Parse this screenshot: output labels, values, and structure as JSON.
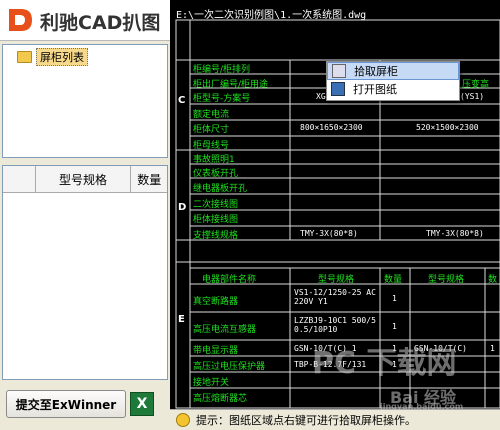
{
  "app": {
    "title": "利驰CAD扒图"
  },
  "tree": {
    "root_label": "屏柜列表"
  },
  "grid": {
    "headers": [
      "",
      "型号规格",
      "数量"
    ]
  },
  "bottom": {
    "submit_label": "提交至ExWinner",
    "excel_icon": "X"
  },
  "drawing": {
    "path": "E:\\一次二次识别例图\\1.一次系统图.dwg",
    "section_c": "C",
    "section_d": "D",
    "section_e": "E",
    "rows_upper": [
      "柜编号/柜排列",
      "柜出厂编号/柜用途",
      "柜型号-方案号",
      "额定电流",
      "柜体尺寸",
      "柜母线号",
      "事故照明1",
      "仪表板开孔",
      "继电器板开孔",
      "二次接线图",
      "柜体接线图",
      "支撑线规格"
    ],
    "values_upper": [
      "XGN",
      "(YS1)",
      "800×1650×2300",
      "520×1500×2300",
      "TMY-3X(80*8)",
      "TMY-3X(80*8)",
      "压变高"
    ],
    "table_head": [
      "电器部件名称",
      "型号规格",
      "数量",
      "型号规格",
      "数"
    ],
    "rows_lower": [
      "真空断路器",
      "高压电流互感器",
      "带电显示器",
      "高压过电压保护器",
      "接地开关",
      "高压熔断器芯"
    ],
    "values_lower": [
      "VS1-12/1250-25 AC 220V Y1",
      "LZZBJ9-10C1 500/5 0.5/10P10",
      "GSN-10/T(C) 1",
      "TBP-B-12.7F/131",
      "1",
      "1",
      "1",
      "1",
      "GSN-10/T(C)",
      "1"
    ]
  },
  "context_menu": {
    "items": [
      "拾取屏柜",
      "打开图纸"
    ]
  },
  "hint": {
    "text": "提示：图纸区域点右键可进行拾取屏柜操作。"
  },
  "watermarks": [
    "PC 下载网",
    "Bai 经验",
    "jingyan.baidu.com"
  ]
}
